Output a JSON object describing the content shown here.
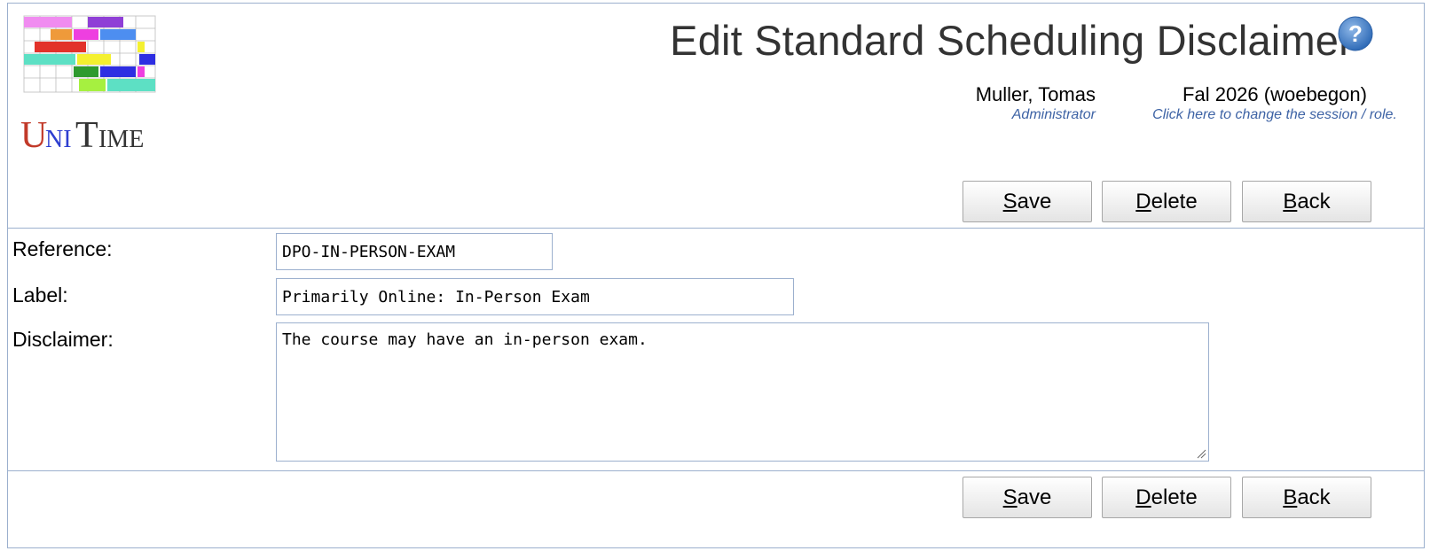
{
  "header": {
    "title": "Edit Standard Scheduling Disclaimer",
    "logo_text": "UniTime",
    "help_icon": "question-circle-icon"
  },
  "user": {
    "name": "Muller, Tomas",
    "role": "Administrator"
  },
  "session": {
    "name": "Fal 2026 (woebegon)",
    "hint": "Click here to change the session / role."
  },
  "buttons": {
    "save": {
      "accesskey": "S",
      "rest": "ave"
    },
    "delete": {
      "accesskey": "D",
      "rest": "elete"
    },
    "back": {
      "accesskey": "B",
      "rest": "ack"
    }
  },
  "form": {
    "reference": {
      "label": "Reference:",
      "value": "DPO-IN-PERSON-EXAM"
    },
    "label": {
      "label": "Label:",
      "value": "Primarily Online: In-Person Exam"
    },
    "disclaimer": {
      "label": "Disclaimer:",
      "value": "The course may have an in-person exam."
    }
  },
  "colors": {
    "border": "#9cb0ce",
    "link": "#3e63a5",
    "title": "#333333"
  }
}
